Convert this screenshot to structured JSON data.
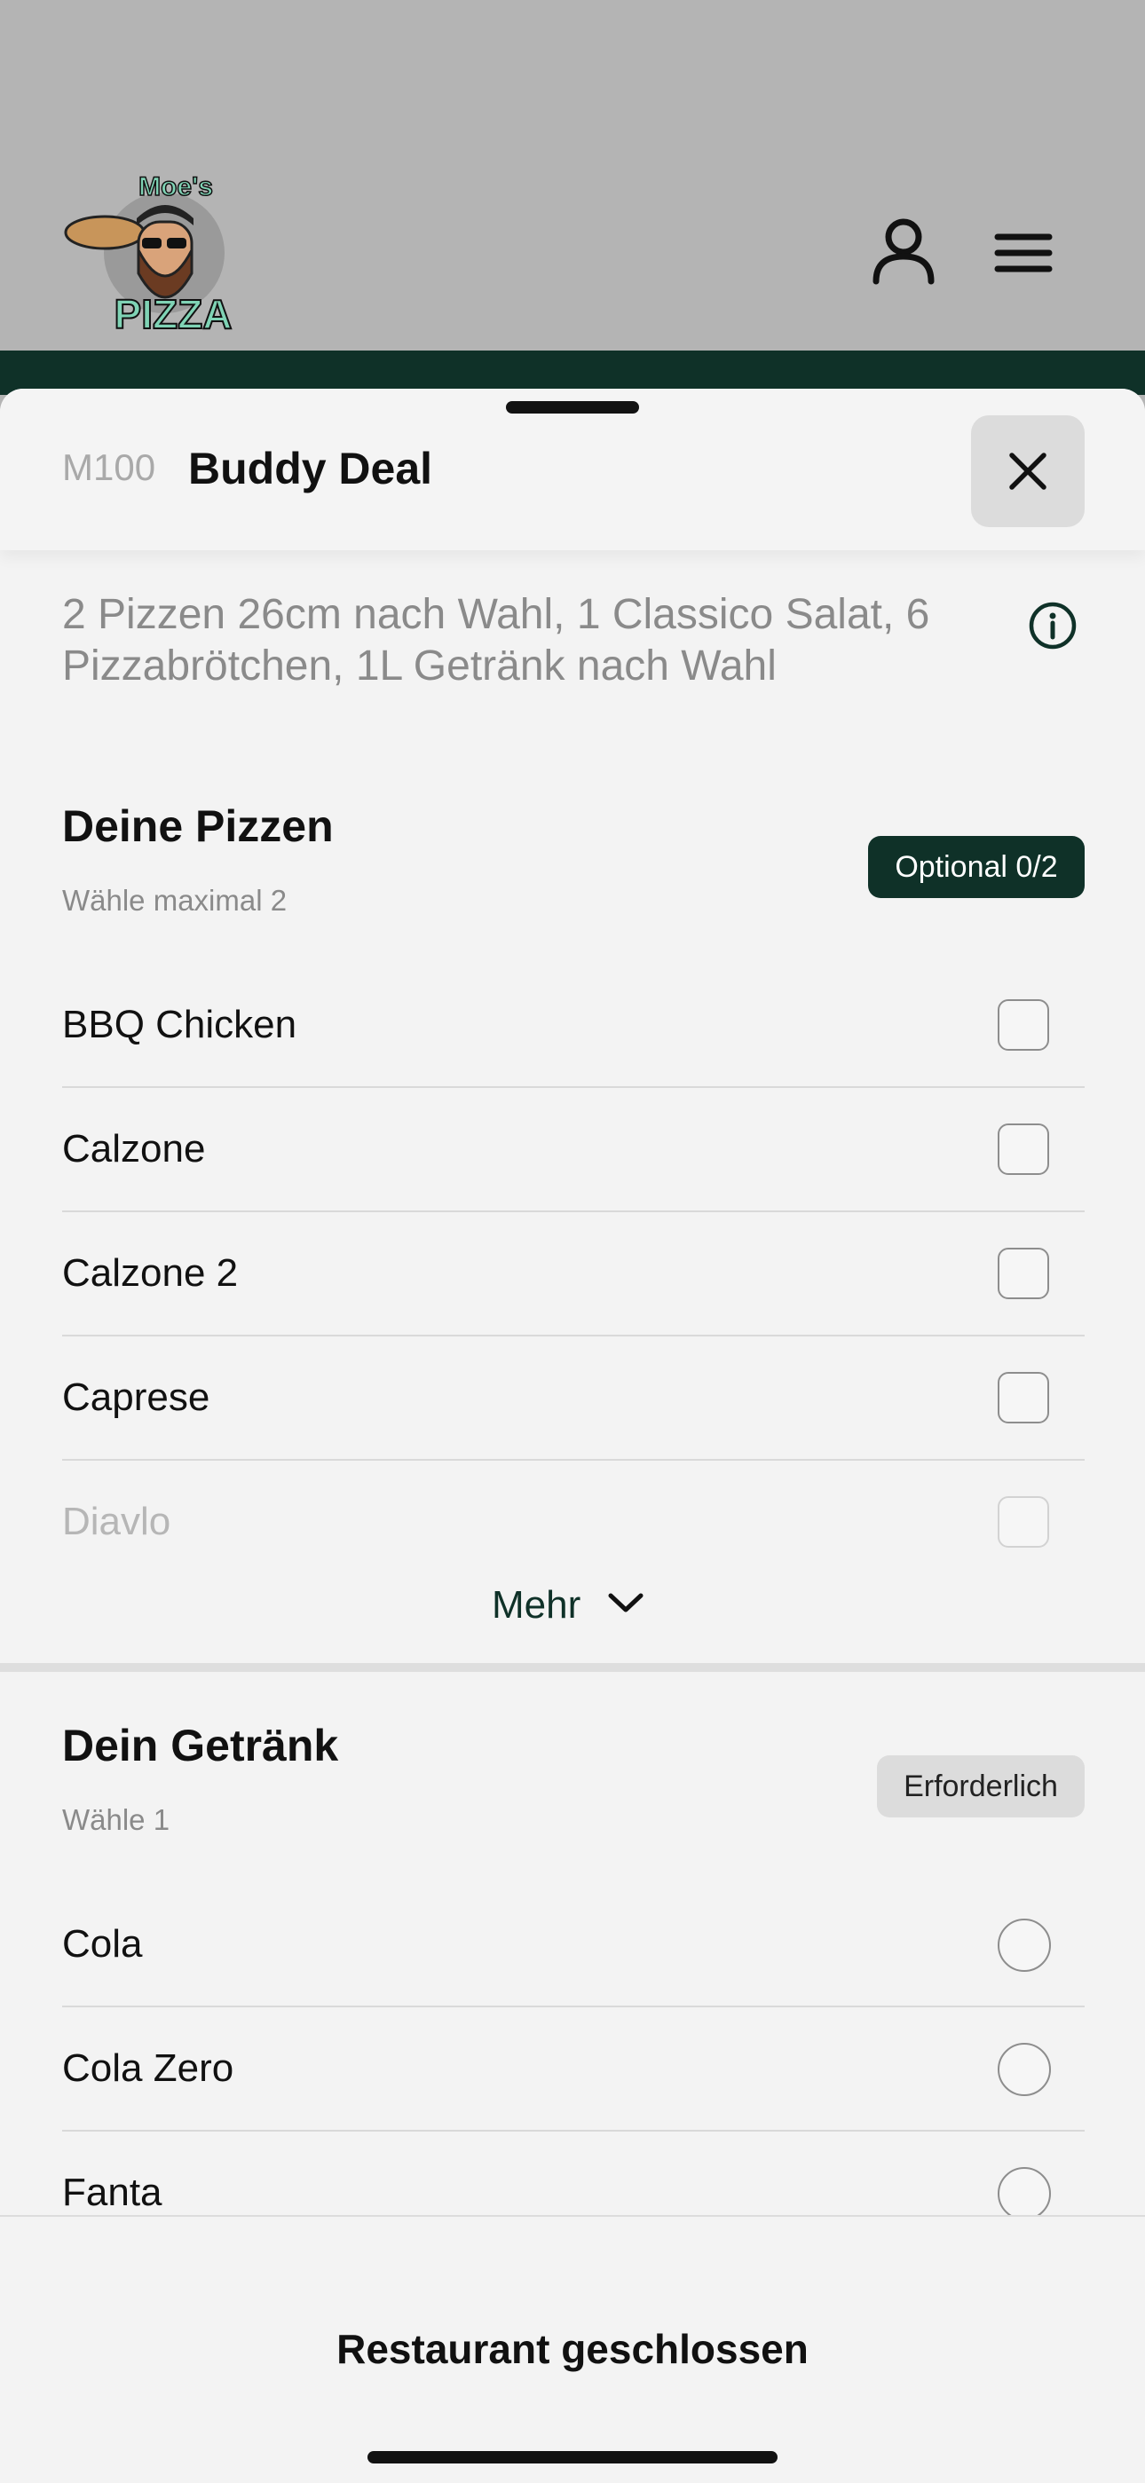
{
  "header": {
    "logo_icon": "moes-pizza-logo",
    "logo_text": "Moe's Pizza",
    "account_icon": "user-icon",
    "menu_icon": "hamburger-menu-icon"
  },
  "item": {
    "code": "M100",
    "title": "Buddy Deal",
    "description": "2 Pizzen 26cm nach Wahl, 1 Classico Salat, 6 Pizzabrötchen, 1L Getränk nach Wahl",
    "close_icon": "close-icon",
    "info_icon": "info-icon"
  },
  "pizza_section": {
    "title": "Deine Pizzen",
    "subtitle": "Wähle maximal 2",
    "badge": "Optional 0/2",
    "options": [
      "BBQ Chicken",
      "Calzone",
      "Calzone 2",
      "Caprese",
      "Diavlo"
    ],
    "more_label": "Mehr"
  },
  "drink_section": {
    "title": "Dein Getränk",
    "subtitle": "Wähle 1",
    "badge": "Erforderlich",
    "options": [
      "Cola",
      "Cola Zero",
      "Fanta"
    ]
  },
  "footer": {
    "status_text": "Restaurant geschlossen"
  },
  "colors": {
    "brand_green": "#0f3128",
    "backdrop": "#b4b4b4",
    "sheet": "#f3f3f3"
  }
}
